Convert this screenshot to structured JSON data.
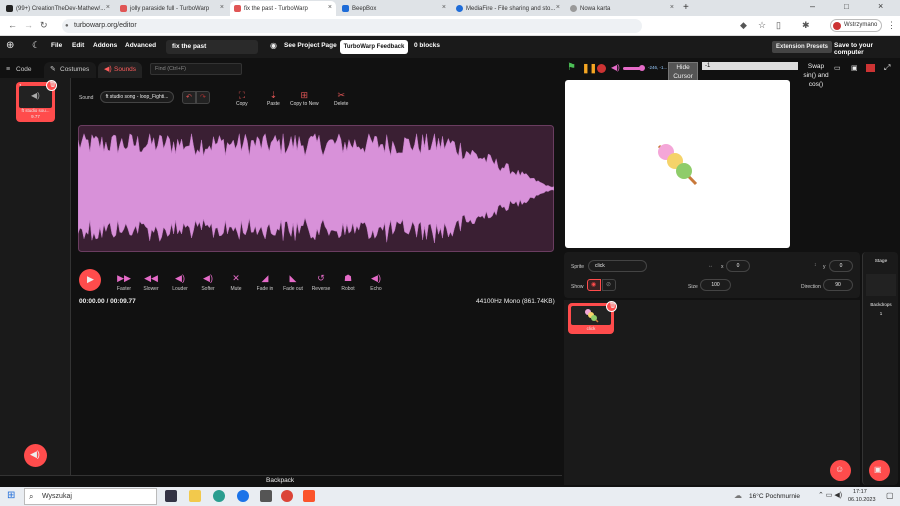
{
  "browser": {
    "tabs": [
      {
        "title": "(99+) CreationTheDev-Mathew/...",
        "color": "#d22"
      },
      {
        "title": "jolly paraside full - TurboWarp",
        "color": "#e05555"
      },
      {
        "title": "fix the past - TurboWarp",
        "color": "#e05555"
      },
      {
        "title": "BeepBox",
        "color": "#1e6cd8"
      },
      {
        "title": "MediaFire - File sharing and sto...",
        "color": "#1e6cd8"
      },
      {
        "title": "Nowa karta",
        "color": "#999"
      }
    ],
    "new_tab_symbol": "+",
    "url": "turbowarp.org/editor",
    "profile_label": "Wstrzymano"
  },
  "menubar": {
    "file": "File",
    "edit": "Edit",
    "addons": "Addons",
    "advanced": "Advanced",
    "project_title": "fix the past",
    "see_project_page": "See Project Page",
    "feedback": "TurboWarp Feedback",
    "blocks": "0 blocks",
    "extension_presets": "Extension Presets",
    "save": "Save to your computer"
  },
  "editor_tabs": {
    "code": "Code",
    "costumes": "Costumes",
    "sounds": "Sounds",
    "find_placeholder": "Find (Ctrl+F)"
  },
  "sound_list": [
    {
      "index": "1",
      "name": "ft studio sou...",
      "duration": "9.77"
    }
  ],
  "sound_editor": {
    "sound_label": "Sound",
    "sound_name": "ft studio song - loop_Fighti...",
    "tools": [
      "Copy",
      "Paste",
      "Copy to New",
      "Delete"
    ],
    "effects": [
      "Faster",
      "Slower",
      "Louder",
      "Softer",
      "Mute",
      "Fade in",
      "Fade out",
      "Reverse",
      "Robot",
      "Echo"
    ],
    "time": "00:00.00 / 00:09.77",
    "info": "44100Hz Mono (861.74KB)"
  },
  "stage_controls": {
    "volume": "-246, -1...",
    "hide_cursor": "Hide Cursor",
    "input_value": "-1",
    "swap_label": "Swap sin() and cos()"
  },
  "sprite_info": {
    "sprite_label": "Sprite",
    "sprite_name": "click",
    "x_label": "x",
    "x_value": "0",
    "y_label": "y",
    "y_value": "0",
    "show_label": "Show",
    "size_label": "Size",
    "size_value": "100",
    "direction_label": "Direction",
    "direction_value": "90"
  },
  "sprites": [
    {
      "name": "click"
    }
  ],
  "stage_panel": {
    "label": "Stage",
    "backdrops_label": "Backdrops",
    "backdrops_count": "1"
  },
  "backpack": "Backpack",
  "taskbar": {
    "search": "Wyszukaj",
    "weather": "16°C  Pochmurnie",
    "time": "17:17",
    "date": "06.10.2023"
  },
  "colors": {
    "accent": "#ff4c4c",
    "waveform": "#d891d9",
    "pink_icon": "#e56bc8"
  }
}
